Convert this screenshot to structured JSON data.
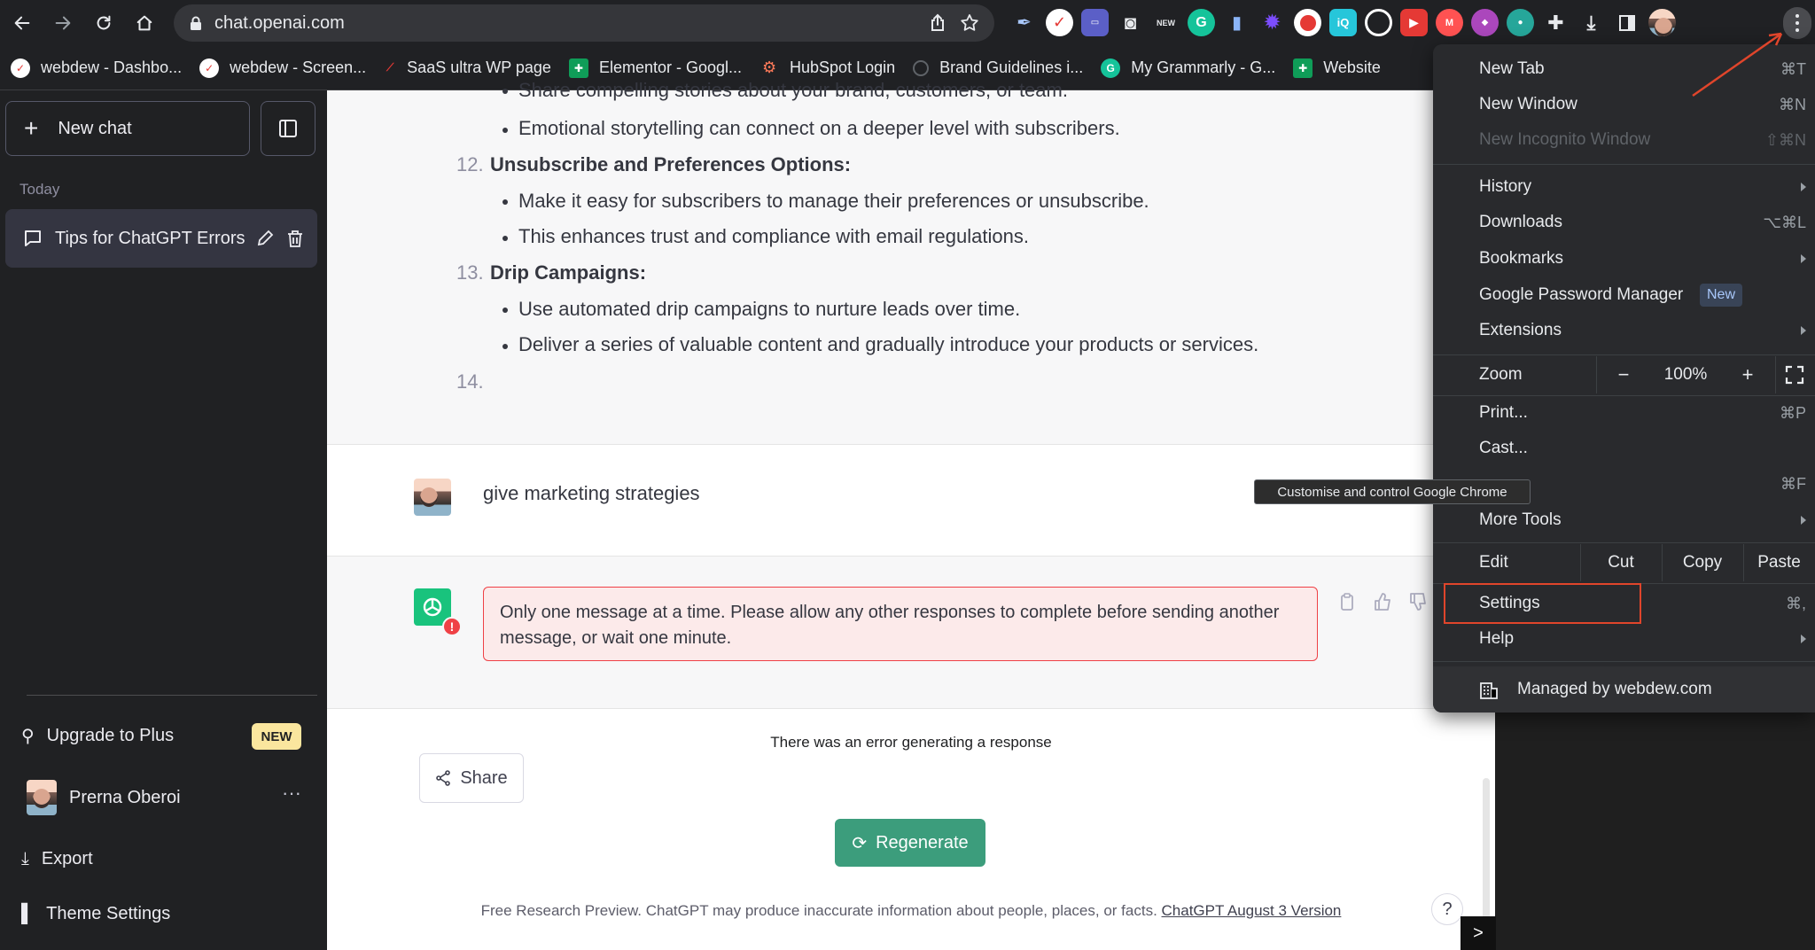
{
  "browser": {
    "url": "chat.openai.com",
    "bookmarks": [
      {
        "label": "webdew - Dashbo...",
        "color": "#e53935"
      },
      {
        "label": "webdew - Screen...",
        "color": "#e53935"
      },
      {
        "label": "SaaS ultra WP page",
        "color": "#d32f2f"
      },
      {
        "label": "Elementor - Googl...",
        "color": "#0f9d58"
      },
      {
        "label": "HubSpot Login",
        "color": "#ff7a59"
      },
      {
        "label": "Brand Guidelines i...",
        "color": "#5f6368"
      },
      {
        "label": "My Grammarly - G...",
        "color": "#15c39a"
      },
      {
        "label": "Website",
        "color": "#0f9d58"
      }
    ],
    "ext_new_label": "NEW"
  },
  "sidebar": {
    "new_chat": "New chat",
    "today": "Today",
    "chat_title": "Tips for ChatGPT Errors",
    "upgrade": "Upgrade to Plus",
    "upgrade_badge": "NEW",
    "user_name": "Prerna Oberoi",
    "more": "···",
    "export": "Export",
    "theme": "Theme Settings"
  },
  "conversation": {
    "lines": {
      "l0": "Share compelling stories about your brand, customers, or team.",
      "l1": "Emotional storytelling can connect on a deeper level with subscribers.",
      "n12": "12.",
      "h12": "Unsubscribe and Preferences Options:",
      "l2": "Make it easy for subscribers to manage their preferences or unsubscribe.",
      "l3": "This enhances trust and compliance with email regulations.",
      "n13": "13.",
      "h13": "Drip Campaigns:",
      "l4": "Use automated drip campaigns to nurture leads over time.",
      "l5": "Deliver a series of valuable content and gradually introduce your products or services.",
      "n14": "14."
    },
    "user_message": "give marketing strategies",
    "error_line1": "Only one message at a time. Please allow any other responses to complete before sending another",
    "error_line2": "message, or wait one minute.",
    "error_generating": "There was an error generating a response",
    "share": "Share",
    "regenerate": "Regenerate",
    "footer_text": "Free Research Preview. ChatGPT may produce inaccurate information about people, places, or facts. ",
    "footer_link": "ChatGPT August 3 Version",
    "help": "?",
    "terminal": ">"
  },
  "chrome_menu": {
    "new_tab": "New Tab",
    "new_tab_sc": "⌘T",
    "new_window": "New Window",
    "new_window_sc": "⌘N",
    "incognito": "New Incognito Window",
    "incognito_sc": "⇧⌘N",
    "history": "History",
    "downloads": "Downloads",
    "downloads_sc": "⌥⌘L",
    "bookmarks": "Bookmarks",
    "password": "Google Password Manager",
    "password_badge": "New",
    "extensions": "Extensions",
    "zoom": "Zoom",
    "zoom_minus": "−",
    "zoom_value": "100%",
    "zoom_plus": "+",
    "print": "Print...",
    "print_sc": "⌘P",
    "cast": "Cast...",
    "find_sc": "⌘F",
    "more_tools": "More Tools",
    "edit": "Edit",
    "cut": "Cut",
    "copy": "Copy",
    "paste": "Paste",
    "settings": "Settings",
    "settings_sc": "⌘,",
    "help": "Help",
    "managed": "Managed by webdew.com"
  },
  "tooltip": "Customise and control Google Chrome",
  "colors": {
    "accent": "#3c9d7c",
    "error": "#ef4146",
    "highlight": "#e0452b"
  }
}
